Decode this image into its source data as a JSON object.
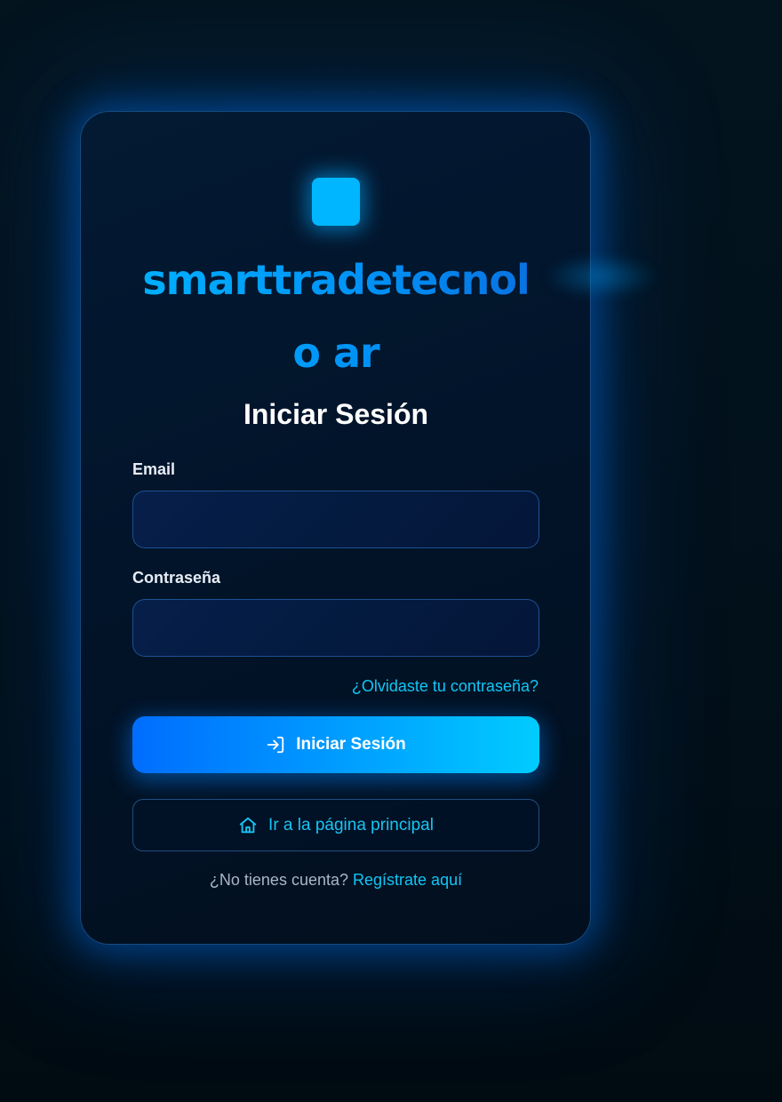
{
  "brand": {
    "name": "smarttradetecnolo ar",
    "logo_icon": "logo-square-icon"
  },
  "login": {
    "title": "Iniciar Sesión",
    "email_label": "Email",
    "email_value": "",
    "password_label": "Contraseña",
    "password_value": "",
    "forgot_link": "¿Olvidaste tu contraseña?",
    "submit_label": "Iniciar Sesión",
    "submit_icon": "login-icon",
    "home_label": "Ir a la página principal",
    "home_icon": "home-icon",
    "no_account_text": "¿No tienes cuenta?",
    "register_link": "Regístrate aquí"
  },
  "colors": {
    "accent": "#00b7ff",
    "link": "#11c6f5",
    "button_start": "#006dff",
    "button_end": "#00ccff",
    "background": "#02101a"
  }
}
